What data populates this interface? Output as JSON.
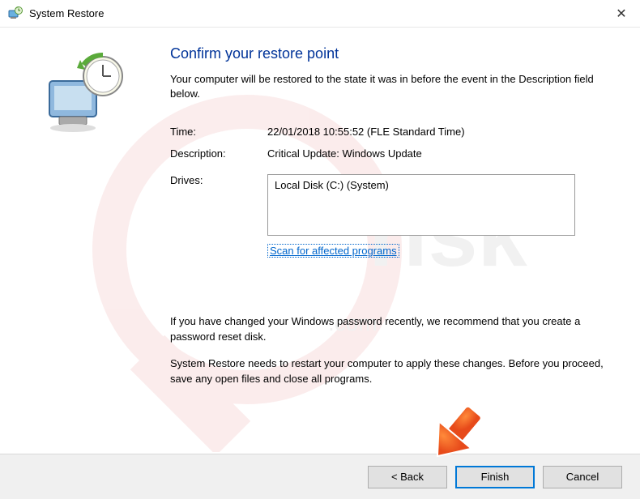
{
  "titlebar": {
    "title": "System Restore",
    "close_symbol": "✕"
  },
  "main": {
    "heading": "Confirm your restore point",
    "intro": "Your computer will be restored to the state it was in before the event in the Description field below.",
    "time_label": "Time:",
    "time_value": "22/01/2018 10:55:52 (FLE Standard Time)",
    "description_label": "Description:",
    "description_value": "Critical Update: Windows Update",
    "drives_label": "Drives:",
    "drives_value": "Local Disk (C:) (System)",
    "scan_link": "Scan for affected programs",
    "note1": "If you have changed your Windows password recently, we recommend that you create a password reset disk.",
    "note2": "System Restore needs to restart your computer to apply these changes. Before you proceed, save any open files and close all programs."
  },
  "footer": {
    "back": "< Back",
    "finish": "Finish",
    "cancel": "Cancel"
  }
}
